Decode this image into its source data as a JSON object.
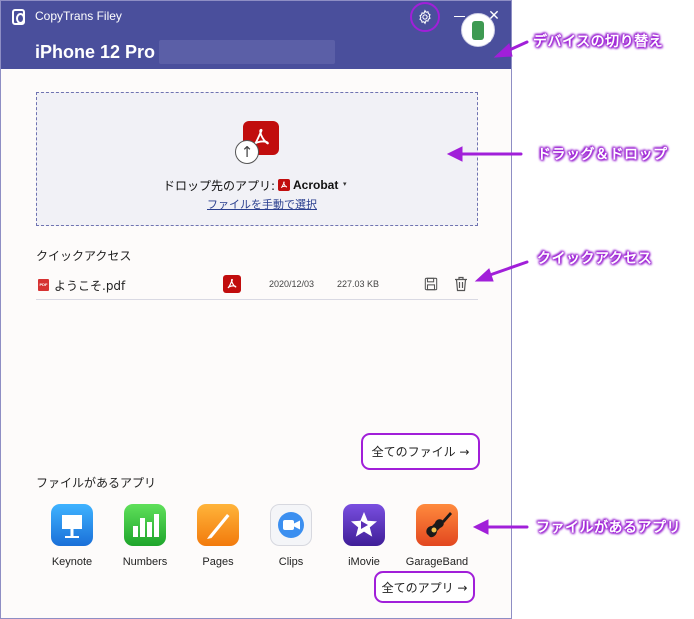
{
  "window": {
    "app_title": "CopyTrans Filey",
    "device_name": "iPhone 12 Pro",
    "close_glyph": "✕"
  },
  "dropzone": {
    "label": "ドロップ先のアプリ:",
    "app_name": "Acrobat",
    "caret": "▾",
    "manual_link": "ファイルを手動で選択",
    "upload_glyph": "↑"
  },
  "quick_access": {
    "title": "クイックアクセス",
    "files": [
      {
        "pdf_tag": "PDF",
        "name": "ようこそ.pdf",
        "date": "2020/12/03",
        "size": "227.03 KB"
      }
    ],
    "all_files_label": "全てのファイル →"
  },
  "apps_section": {
    "title": "ファイルがあるアプリ",
    "apps": [
      {
        "label": "Keynote",
        "icon": "keynote-icon",
        "color": "#1f8be6"
      },
      {
        "label": "Numbers",
        "icon": "numbers-icon",
        "color": "#2dbd3a"
      },
      {
        "label": "Pages",
        "icon": "pages-icon",
        "color": "#f68a14"
      },
      {
        "label": "Clips",
        "icon": "clips-icon",
        "color": "#3b8ff0"
      },
      {
        "label": "iMovie",
        "icon": "imovie-icon",
        "color": "#5a2fb6"
      },
      {
        "label": "GarageBand",
        "icon": "garageband-icon",
        "color": "#f26a2e"
      }
    ],
    "all_apps_label": "全てのアプリ →"
  },
  "annotations": {
    "device_switch": "デバイスの切り替え",
    "drag_drop": "ドラッグ＆ドロップ",
    "quick_access": "クイックアクセス",
    "apps_with_files": "ファイルがあるアプリ"
  },
  "colors": {
    "titlebar": "#4a4f9c",
    "accent_highlight": "#a11fd9",
    "acrobat_red": "#c10d0d"
  }
}
